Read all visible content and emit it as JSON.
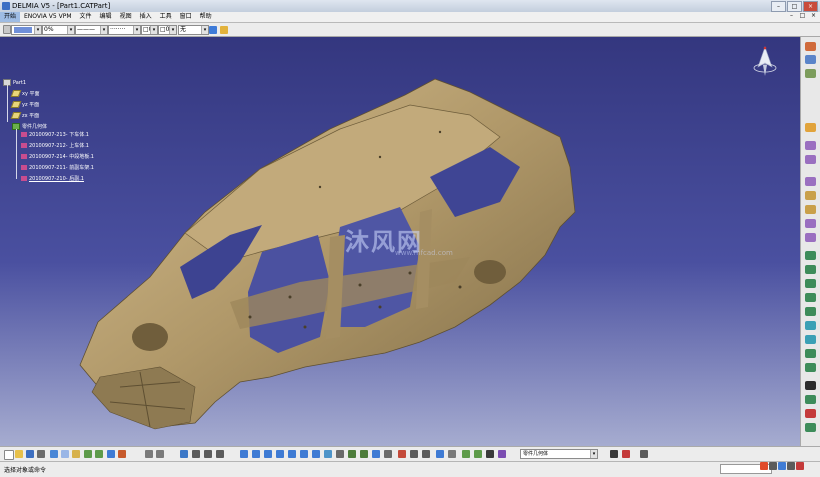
{
  "window": {
    "title": "DELMIA V5 - [Part1.CATPart]",
    "controls": [
      "–",
      "□",
      "×"
    ]
  },
  "menu": {
    "items": [
      "开始",
      "ENOVIA V5 VPM",
      "文件",
      "编辑",
      "视图",
      "插入",
      "工具",
      "窗口",
      "帮助"
    ],
    "active_index": 0,
    "mdi_controls": [
      "–",
      "□",
      "×"
    ]
  },
  "properties_toolbar": {
    "fill_value": "",
    "transparency": "0%",
    "linetype": "———",
    "linestyle": "········",
    "thickness": "□0",
    "point": "□0",
    "layer": "无"
  },
  "tree": [
    {
      "label": "Part1",
      "icon": "part-icon",
      "level": 0
    },
    {
      "label": "xy 平面",
      "icon": "plane-icon",
      "level": 1
    },
    {
      "label": "yz 平面",
      "icon": "plane-icon",
      "level": 1
    },
    {
      "label": "zx 平面",
      "icon": "plane-icon",
      "level": 1
    },
    {
      "label": "零件几何体",
      "icon": "body-icon",
      "level": 1
    },
    {
      "label": "20100907-213- 下车体.1",
      "icon": "product-icon",
      "level": 2
    },
    {
      "label": "20100907-212- 上车体.1",
      "icon": "product-icon",
      "level": 2
    },
    {
      "label": "20100907-214- 中段地板.1",
      "icon": "product-icon",
      "level": 2
    },
    {
      "label": "20100907-211- 前副车架.1",
      "icon": "product-icon",
      "level": 2
    },
    {
      "label": "20100907-210- 后副.1",
      "icon": "product-icon",
      "level": 2
    }
  ],
  "viewport": {
    "watermark": "沐风网",
    "watermark_url": "www.mfcad.com",
    "model": "car-body-in-white",
    "colors": {
      "model": "#b09869",
      "model_shadow": "#7d6a45",
      "background_top": "#34377f",
      "background_bottom": "#a6acd0"
    }
  },
  "selection": {
    "value": "零件几何体"
  },
  "status": {
    "text": "选择对象或命令"
  },
  "icons": {
    "compass": "compass-icon",
    "axes": "xyz-axes-icon"
  }
}
